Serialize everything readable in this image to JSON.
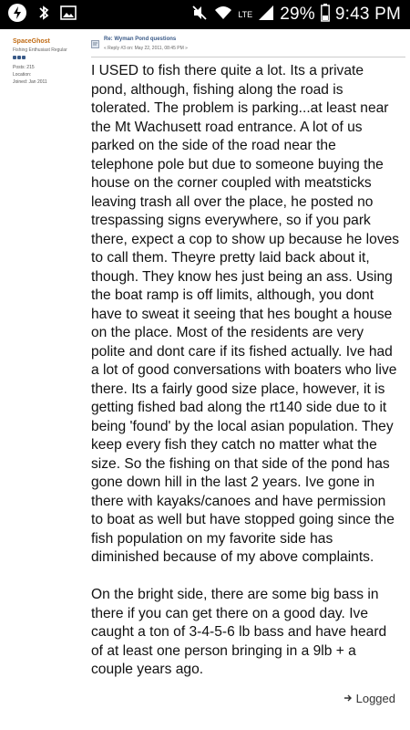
{
  "status_bar": {
    "left_icons": [
      "power-icon",
      "bluetooth-icon",
      "gallery-icon"
    ],
    "right_icons": [
      "mute-icon",
      "wifi-icon",
      "lte-icon",
      "signal-icon"
    ],
    "lte_label": "LTE",
    "battery": "29%",
    "time": "9:43 PM"
  },
  "poster": {
    "name": "SpaceGhost",
    "title": "Fishing Enthusiast Regular",
    "rank_count": 3,
    "posts_label": "Posts: 215",
    "location_label": "Location:",
    "joined_label": "Joined: Jan 2011"
  },
  "post": {
    "subject": "Re: Wyman Pond questions",
    "date": "« Reply #3 on: May 22, 2011, 08:45 PM »",
    "paragraphs": [
      "I USED to fish there quite a lot. Its a private pond, although, fishing along the road is tolerated. The problem is parking...at least near the Mt Wachusett road entrance. A lot of us parked on the side of the road near the telephone pole but due to someone buying the house on the corner coupled with meatsticks leaving trash all over the place, he posted no trespassing signs everywhere, so if you park there, expect a cop to show up because he loves to call them. Theyre pretty laid back about it, though. They know hes just being an ass. Using the boat ramp is off limits, although, you dont have to sweat it seeing that hes bought a house on the place. Most of the residents are very polite and dont care if its fished actually. Ive had a lot of good conversations with boaters who live there. Its a fairly good size place, however, it is getting fished bad along the rt140 side due to it being 'found' by the local asian population. They keep every fish they catch no matter what the size. So the fishing on that side of the pond has gone down hill in the last 2 years. Ive gone in there with kayaks/canoes and have permission to boat as well but have stopped going since the fish population on my favorite side has diminished because of my above complaints.",
      "On the bright side, there are some big bass in there if you can get there on a good day. Ive caught a ton of 3-4-5-6 lb bass and have heard of at least one person bringing in a 9lb + a couple years ago."
    ],
    "logged_label": "Logged"
  }
}
